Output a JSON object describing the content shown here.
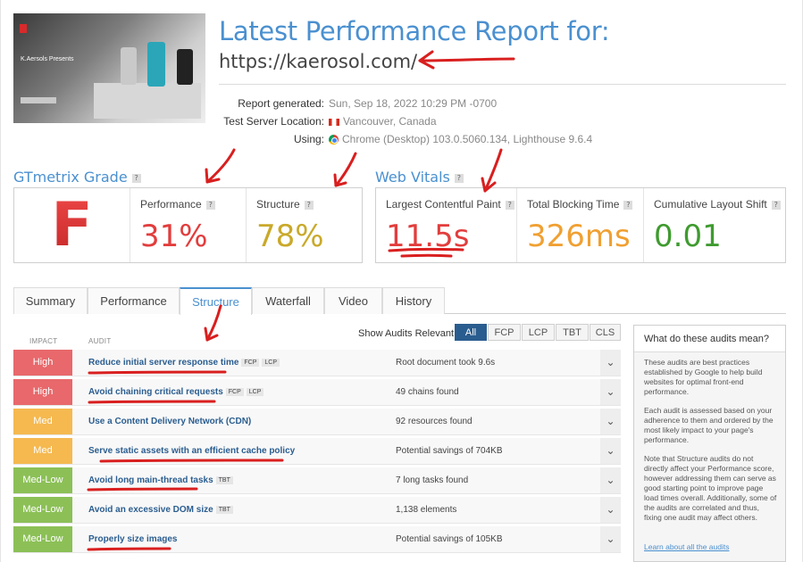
{
  "header": {
    "title": "Latest Performance Report for:",
    "url": "https://kaerosol.com/",
    "thumb_text": "K.Aersols Presents",
    "meta": [
      {
        "key": "Report generated:",
        "value": "Sun, Sep 18, 2022 10:29 PM -0700",
        "icon": ""
      },
      {
        "key": "Test Server Location:",
        "value": "Vancouver, Canada",
        "icon": "canada-flag-icon"
      },
      {
        "key": "Using:",
        "value": "Chrome (Desktop) 103.0.5060.134, Lighthouse 9.6.4",
        "icon": "chrome-icon"
      }
    ]
  },
  "grade": {
    "title": "GTmetrix Grade",
    "letter": "F",
    "performance_label": "Performance",
    "performance_value": "31%",
    "structure_label": "Structure",
    "structure_value": "78%"
  },
  "vitals": {
    "title": "Web Vitals",
    "lcp_label": "Largest Contentful Paint",
    "lcp_value": "11.5s",
    "tbt_label": "Total Blocking Time",
    "tbt_value": "326ms",
    "cls_label": "Cumulative Layout Shift",
    "cls_value": "0.01"
  },
  "colors": {
    "accent": "#4a90d0",
    "bad": "#e23d3d",
    "warn": "#c9a92a",
    "orange": "#f0a032",
    "good": "#3f9b2f"
  },
  "tabs": [
    "Summary",
    "Performance",
    "Structure",
    "Waterfall",
    "Video",
    "History"
  ],
  "active_tab": "Structure",
  "audits": {
    "impact_head": "IMPACT",
    "audit_head": "AUDIT",
    "show_label": "Show Audits Relevant to",
    "filters": [
      "All",
      "FCP",
      "LCP",
      "TBT",
      "CLS"
    ],
    "rows": [
      {
        "impact": "High",
        "level": "high",
        "name": "Reduce initial server response time",
        "tags": [
          "FCP",
          "LCP"
        ],
        "result": "Root document took 9.6s"
      },
      {
        "impact": "High",
        "level": "high",
        "name": "Avoid chaining critical requests",
        "tags": [
          "FCP",
          "LCP"
        ],
        "result": "49 chains found"
      },
      {
        "impact": "Med",
        "level": "med",
        "name": "Use a Content Delivery Network (CDN)",
        "tags": [],
        "result": "92 resources found"
      },
      {
        "impact": "Med",
        "level": "med",
        "name": "Serve static assets with an efficient cache policy",
        "tags": [],
        "result": "Potential savings of 704KB"
      },
      {
        "impact": "Med-Low",
        "level": "medlow",
        "name": "Avoid long main-thread tasks",
        "tags": [
          "TBT"
        ],
        "result": "7 long tasks found"
      },
      {
        "impact": "Med-Low",
        "level": "medlow",
        "name": "Avoid an excessive DOM size",
        "tags": [
          "TBT"
        ],
        "result": "1,138 elements"
      },
      {
        "impact": "Med-Low",
        "level": "medlow",
        "name": "Properly size images",
        "tags": [],
        "result": "Potential savings of 105KB"
      }
    ]
  },
  "side": {
    "heading": "What do these audits mean?",
    "p1": "These audits are best practices established by Google to help build websites for optimal front-end performance.",
    "p2": "Each audit is assessed based on your adherence to them and ordered by the most likely impact to your page's performance.",
    "p3": "Note that Structure audits do not directly affect your Performance score, however addressing them can serve as good starting point to improve page load times overall. Additionally, some of the audits are correlated and thus, fixing one audit may affect others.",
    "link": "Learn about all the audits"
  }
}
